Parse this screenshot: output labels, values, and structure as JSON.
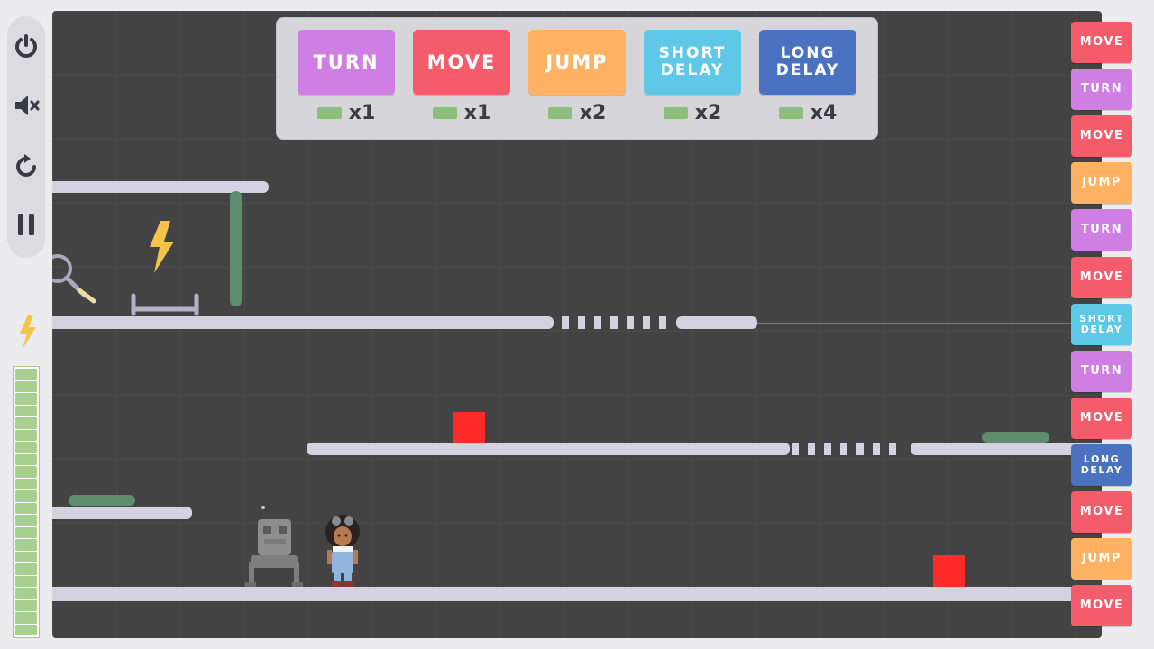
{
  "controls": {
    "power": "power-icon",
    "mute": "mute-icon",
    "restart": "restart-icon",
    "pause": "pause-icon"
  },
  "energy": {
    "icon": "lightning-icon",
    "segments": 22,
    "filled": 22
  },
  "palette": [
    {
      "label": "TURN",
      "count": "x1",
      "color": "#cf7ee3"
    },
    {
      "label": "MOVE",
      "count": "x1",
      "color": "#f45b6b"
    },
    {
      "label": "JUMP",
      "count": "x2",
      "color": "#ffb263"
    },
    {
      "label": "SHORT DELAY",
      "count": "x2",
      "color": "#5ec8e6"
    },
    {
      "label": "LONG DELAY",
      "count": "x4",
      "color": "#4a72c0"
    }
  ],
  "queue": [
    {
      "label": "MOVE",
      "color": "#f45b6b"
    },
    {
      "label": "TURN",
      "color": "#cf7ee3"
    },
    {
      "label": "MOVE",
      "color": "#f45b6b"
    },
    {
      "label": "JUMP",
      "color": "#ffb263"
    },
    {
      "label": "TURN",
      "color": "#cf7ee3"
    },
    {
      "label": "MOVE",
      "color": "#f45b6b"
    },
    {
      "label": "SHORT DELAY",
      "color": "#5ec8e6"
    },
    {
      "label": "TURN",
      "color": "#cf7ee3"
    },
    {
      "label": "MOVE",
      "color": "#f45b6b"
    },
    {
      "label": "LONG DELAY",
      "color": "#4a72c0"
    },
    {
      "label": "MOVE",
      "color": "#f45b6b"
    },
    {
      "label": "JUMP",
      "color": "#ffb263"
    },
    {
      "label": "MOVE",
      "color": "#f45b6b"
    }
  ],
  "colors": {
    "board": "#434343",
    "platform": "#d4d2e0",
    "hazard_block": "#ff2a2a",
    "switch_pad": "#5e8c6c",
    "lightning": "#f3c34a"
  }
}
